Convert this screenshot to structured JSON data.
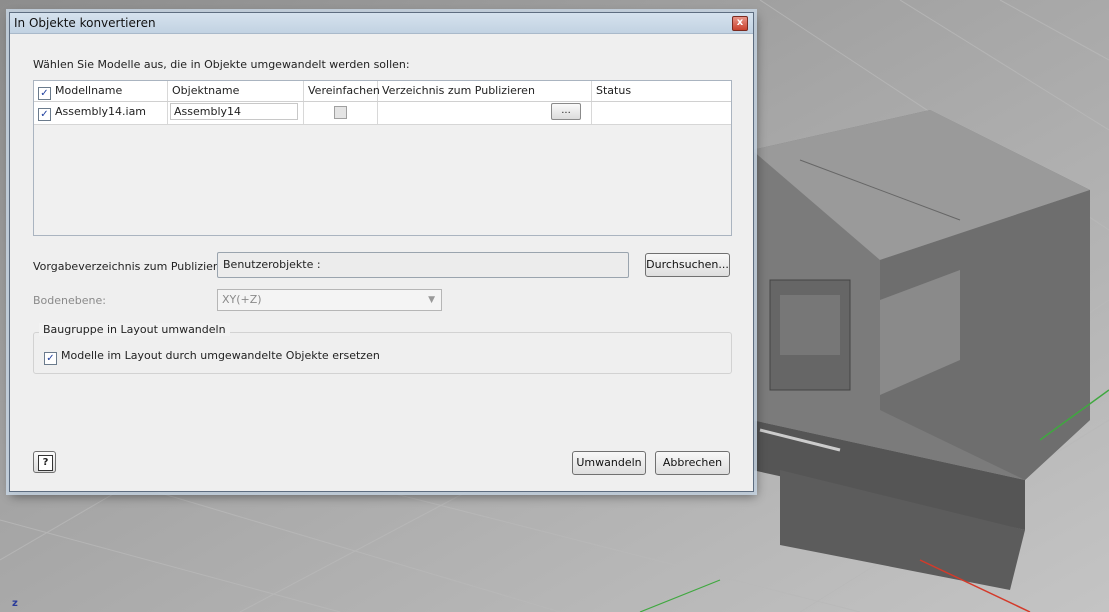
{
  "dialog": {
    "title": "In Objekte konvertieren",
    "instruction": "Wählen Sie Modelle aus, die in Objekte umgewandelt werden sollen:",
    "table": {
      "columns": [
        "Modellname",
        "Objektname",
        "Vereinfachen",
        "Verzeichnis zum Publizieren",
        "Status"
      ],
      "header_checked": true,
      "rows": [
        {
          "checked": true,
          "model": "Assembly14.iam",
          "object": "Assembly14",
          "simplify": false,
          "directory": "",
          "browse_label": "...",
          "status": ""
        }
      ]
    },
    "publish_dir_label": "Vorgabeverzeichnis zum Publizieren:",
    "publish_dir_value": "Benutzerobjekte :",
    "browse_button": "Durchsuchen...",
    "ground_plane_label": "Bodenebene:",
    "ground_plane_value": "XY(+Z)",
    "group_title": "Baugruppe in Layout umwandeln",
    "replace_checkbox_label": "Modelle im Layout durch umgewandelte Objekte ersetzen",
    "replace_checked": true,
    "convert_button": "Umwandeln",
    "cancel_button": "Abbrechen",
    "help_glyph": "?",
    "close_glyph": "x"
  },
  "viewport": {
    "axis_label": "z"
  },
  "colors": {
    "background": "#9a9a9a",
    "model": "#7b7b7b",
    "axis_red": "#d43a2a",
    "axis_green": "#3fa83f"
  }
}
